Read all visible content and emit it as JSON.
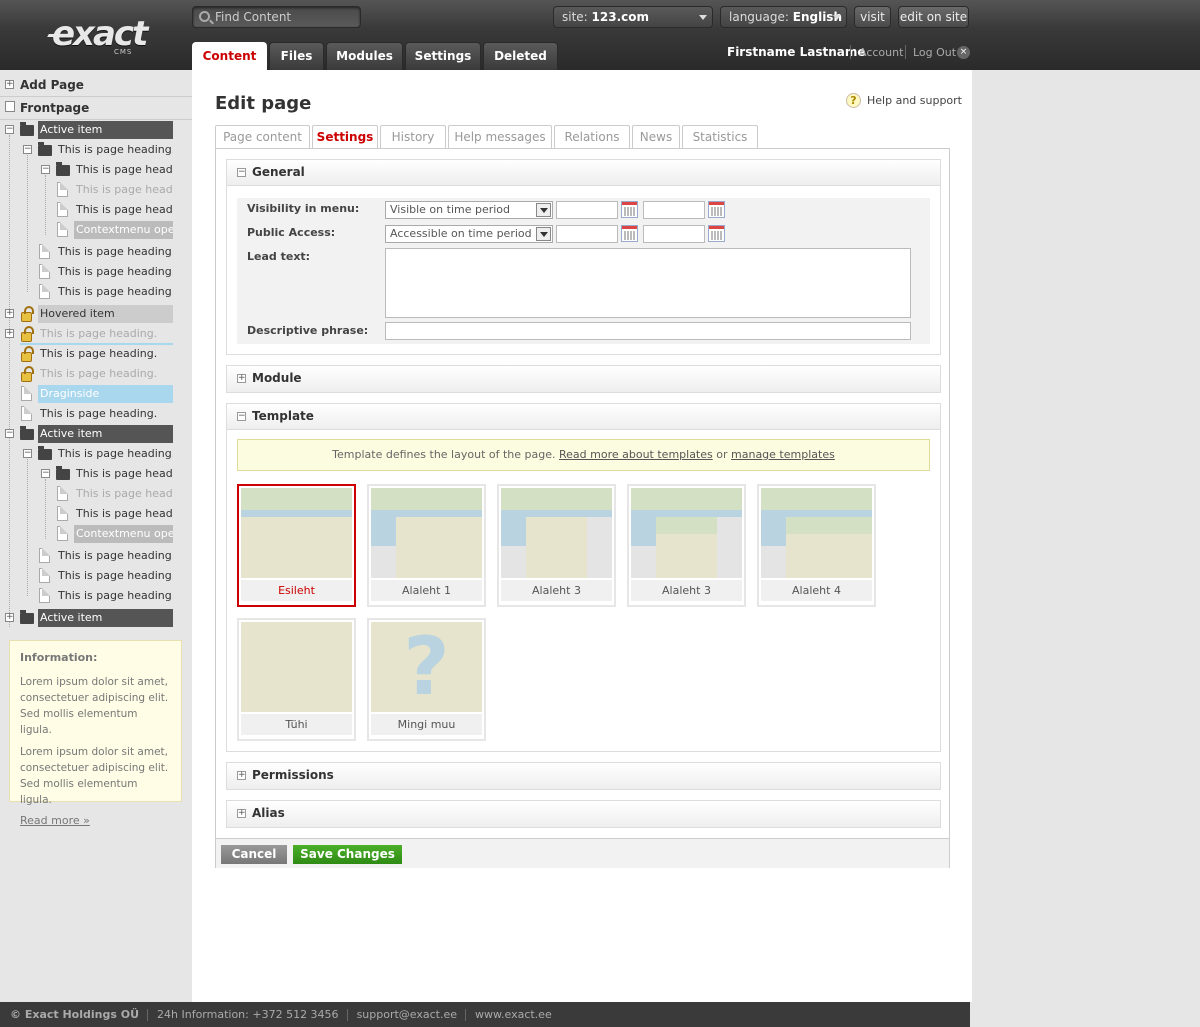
{
  "header": {
    "logo_text": "exact",
    "logo_sub": "CMS",
    "search_placeholder": "Find Content",
    "site_label": "site:",
    "site_value": "123.com",
    "language_label": "language:",
    "language_value": "English",
    "visit_label": "visit",
    "edit_on_site_label": "edit on site",
    "tabs": [
      "Content",
      "Files",
      "Modules",
      "Settings",
      "Deleted"
    ],
    "active_tab": "Content",
    "user_name": "Firstname Lastname",
    "account_label": "Account",
    "logout_label": "Log Out"
  },
  "sidebar": {
    "add_page": "Add Page",
    "frontpage": "Frontpage",
    "tree": [
      "Active item",
      "This is page heading.",
      "This is page headi...",
      "This is page headi...",
      "This is page headi...",
      "Contextmenu ope...",
      "This is page heading.",
      "This is page heading.",
      "This is page heading.",
      "Hovered item",
      "This is page heading.",
      "This is page heading.",
      "This is page heading.",
      "Draginside",
      "This is page heading.",
      "Active item",
      "This is page heading.",
      "This is page headi...",
      "This is page headi...",
      "This is page headi...",
      "Contextmenu ope...",
      "This is page heading.",
      "This is page heading.",
      "This is page heading.",
      "Active item"
    ],
    "info": {
      "title": "Information:",
      "para1": "Lorem ipsum dolor sit amet, consectetuer adipiscing elit. Sed mollis elementum ligula.",
      "para2": "Lorem ipsum dolor sit amet, consectetuer adipiscing elit. Sed mollis elementum ligula.",
      "read_more": "Read more »"
    }
  },
  "main": {
    "title": "Edit page",
    "help": "Help and support",
    "subtabs": [
      "Page content",
      "Settings",
      "History",
      "Help messages",
      "Relations",
      "News",
      "Statistics"
    ],
    "active_subtab": "Settings",
    "general": {
      "title": "General",
      "visibility_label": "Visibility in menu:",
      "visibility_value": "Visible on time period",
      "public_label": "Public Access:",
      "public_value": "Accessible on time period",
      "lead_label": "Lead text:",
      "phrase_label": "Descriptive phrase:"
    },
    "module_title": "Module",
    "template": {
      "title": "Template",
      "note_text": "Template defines the layout of the page.",
      "note_link1": "Read more about templates",
      "note_or": "or",
      "note_link2": "manage templates",
      "items": [
        "Esileht",
        "Alaleht 1",
        "Alaleht 3",
        "Alaleht 3",
        "Alaleht 4",
        "Tühi",
        "Mingi muu"
      ],
      "selected": "Esileht"
    },
    "permissions_title": "Permissions",
    "alias_title": "Alias",
    "cancel_label": "Cancel",
    "save_label": "Save Changes"
  },
  "footer": {
    "copyright": "© Exact Holdings OÜ",
    "phone": "24h Information: +372 512 3456",
    "email": "support@exact.ee",
    "web": "www.exact.ee"
  },
  "colors": {
    "accent": "#cc0000",
    "save_green": "#3a9a1a",
    "active_item_bg": "#555555",
    "drag_bg": "#a9d7ee",
    "template_green": "#d4e0c4",
    "template_blue": "#bad3e0",
    "template_beige": "#e6e4cc"
  }
}
